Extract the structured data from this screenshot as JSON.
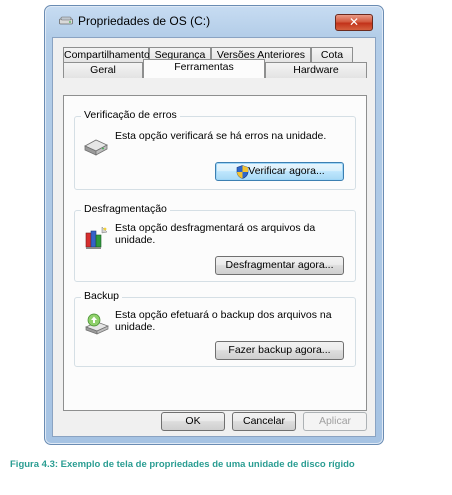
{
  "window": {
    "title": "Propriedades de OS (C:)",
    "close_label": "✕"
  },
  "tabs": {
    "row1": [
      "Compartilhamento",
      "Segurança",
      "Versões Anteriores",
      "Cota"
    ],
    "row2": [
      "Geral",
      "Ferramentas",
      "Hardware"
    ],
    "selected": "Ferramentas"
  },
  "groups": {
    "error_check": {
      "title": "Verificação de erros",
      "description": "Esta opção verificará se há erros na unidade.",
      "button_label": "Verificar agora..."
    },
    "defrag": {
      "title": "Desfragmentação",
      "description": "Esta opção desfragmentará os arquivos da unidade.",
      "button_label": "Desfragmentar agora..."
    },
    "backup": {
      "title": "Backup",
      "description": "Esta opção efetuará o backup dos arquivos na unidade.",
      "button_label": "Fazer backup agora..."
    }
  },
  "footer": {
    "ok_label": "OK",
    "cancel_label": "Cancelar",
    "apply_label": "Aplicar"
  },
  "caption": "Figura 4.3: Exemplo de tela de propriedades de uma unidade de disco rígido",
  "colors": {
    "caption": "#2a9d92",
    "close_button": "#c2331a",
    "window_frame": "#a6c3e3"
  }
}
